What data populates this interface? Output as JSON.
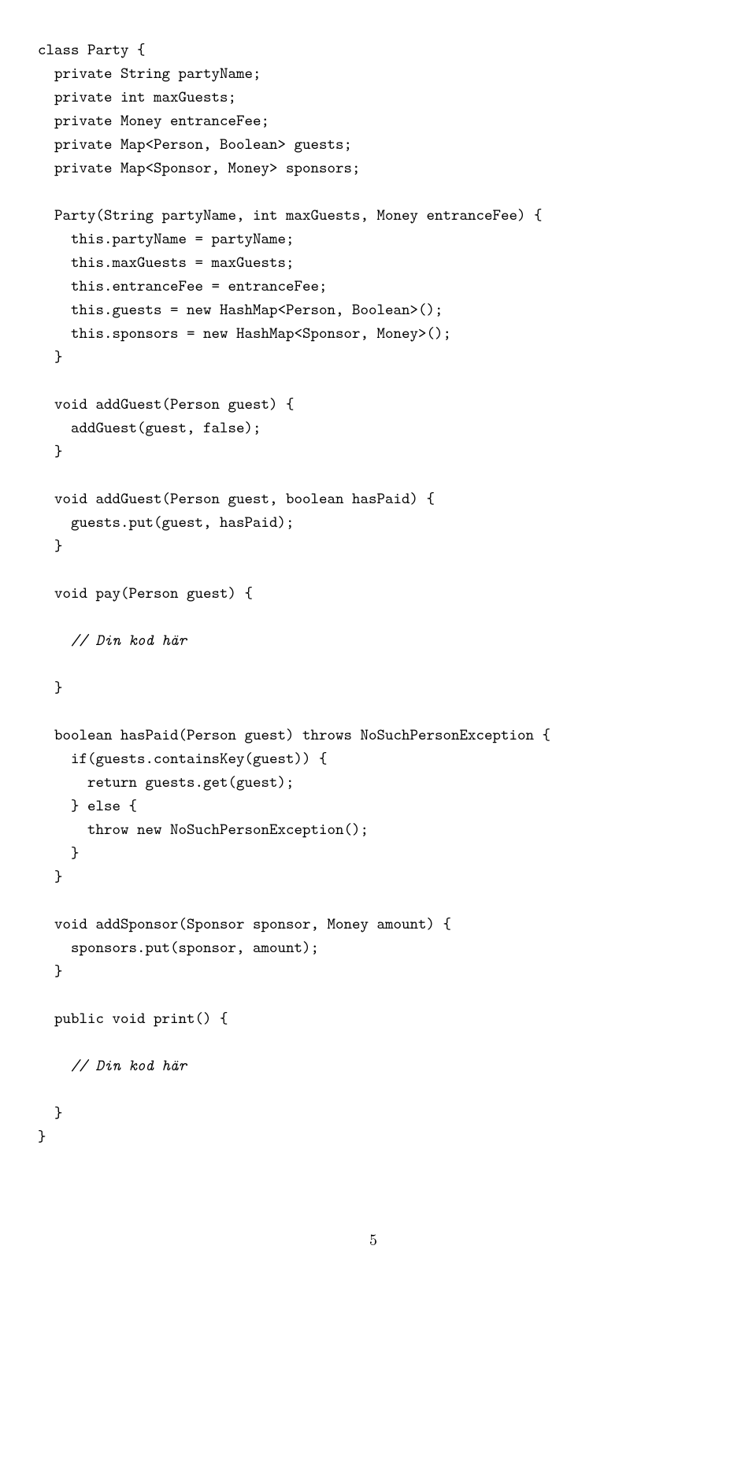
{
  "code": {
    "l1": "class Party {",
    "l2": "  private String partyName;",
    "l3": "  private int maxGuests;",
    "l4": "  private Money entranceFee;",
    "l5": "  private Map<Person, Boolean> guests;",
    "l6": "  private Map<Sponsor, Money> sponsors;",
    "l7": "",
    "l8": "  Party(String partyName, int maxGuests, Money entranceFee) {",
    "l9": "    this.partyName = partyName;",
    "l10": "    this.maxGuests = maxGuests;",
    "l11": "    this.entranceFee = entranceFee;",
    "l12": "    this.guests = new HashMap<Person, Boolean>();",
    "l13": "    this.sponsors = new HashMap<Sponsor, Money>();",
    "l14": "  }",
    "l15": "",
    "l16": "  void addGuest(Person guest) {",
    "l17": "    addGuest(guest, false);",
    "l18": "  }",
    "l19": "",
    "l20": "  void addGuest(Person guest, boolean hasPaid) {",
    "l21": "    guests.put(guest, hasPaid);",
    "l22": "  }",
    "l23": "",
    "l24": "  void pay(Person guest) {",
    "l25": "",
    "l26_comment": "    // Din kod här",
    "l27": "",
    "l28": "  }",
    "l29": "",
    "l30": "  boolean hasPaid(Person guest) throws NoSuchPersonException {",
    "l31": "    if(guests.containsKey(guest)) {",
    "l32": "      return guests.get(guest);",
    "l33": "    } else {",
    "l34": "      throw new NoSuchPersonException();",
    "l35": "    }",
    "l36": "  }",
    "l37": "",
    "l38": "  void addSponsor(Sponsor sponsor, Money amount) {",
    "l39": "    sponsors.put(sponsor, amount);",
    "l40": "  }",
    "l41": "",
    "l42": "  public void print() {",
    "l43": "",
    "l44_comment": "    // Din kod här",
    "l45": "",
    "l46": "  }",
    "l47": "}"
  },
  "page_number": "5"
}
